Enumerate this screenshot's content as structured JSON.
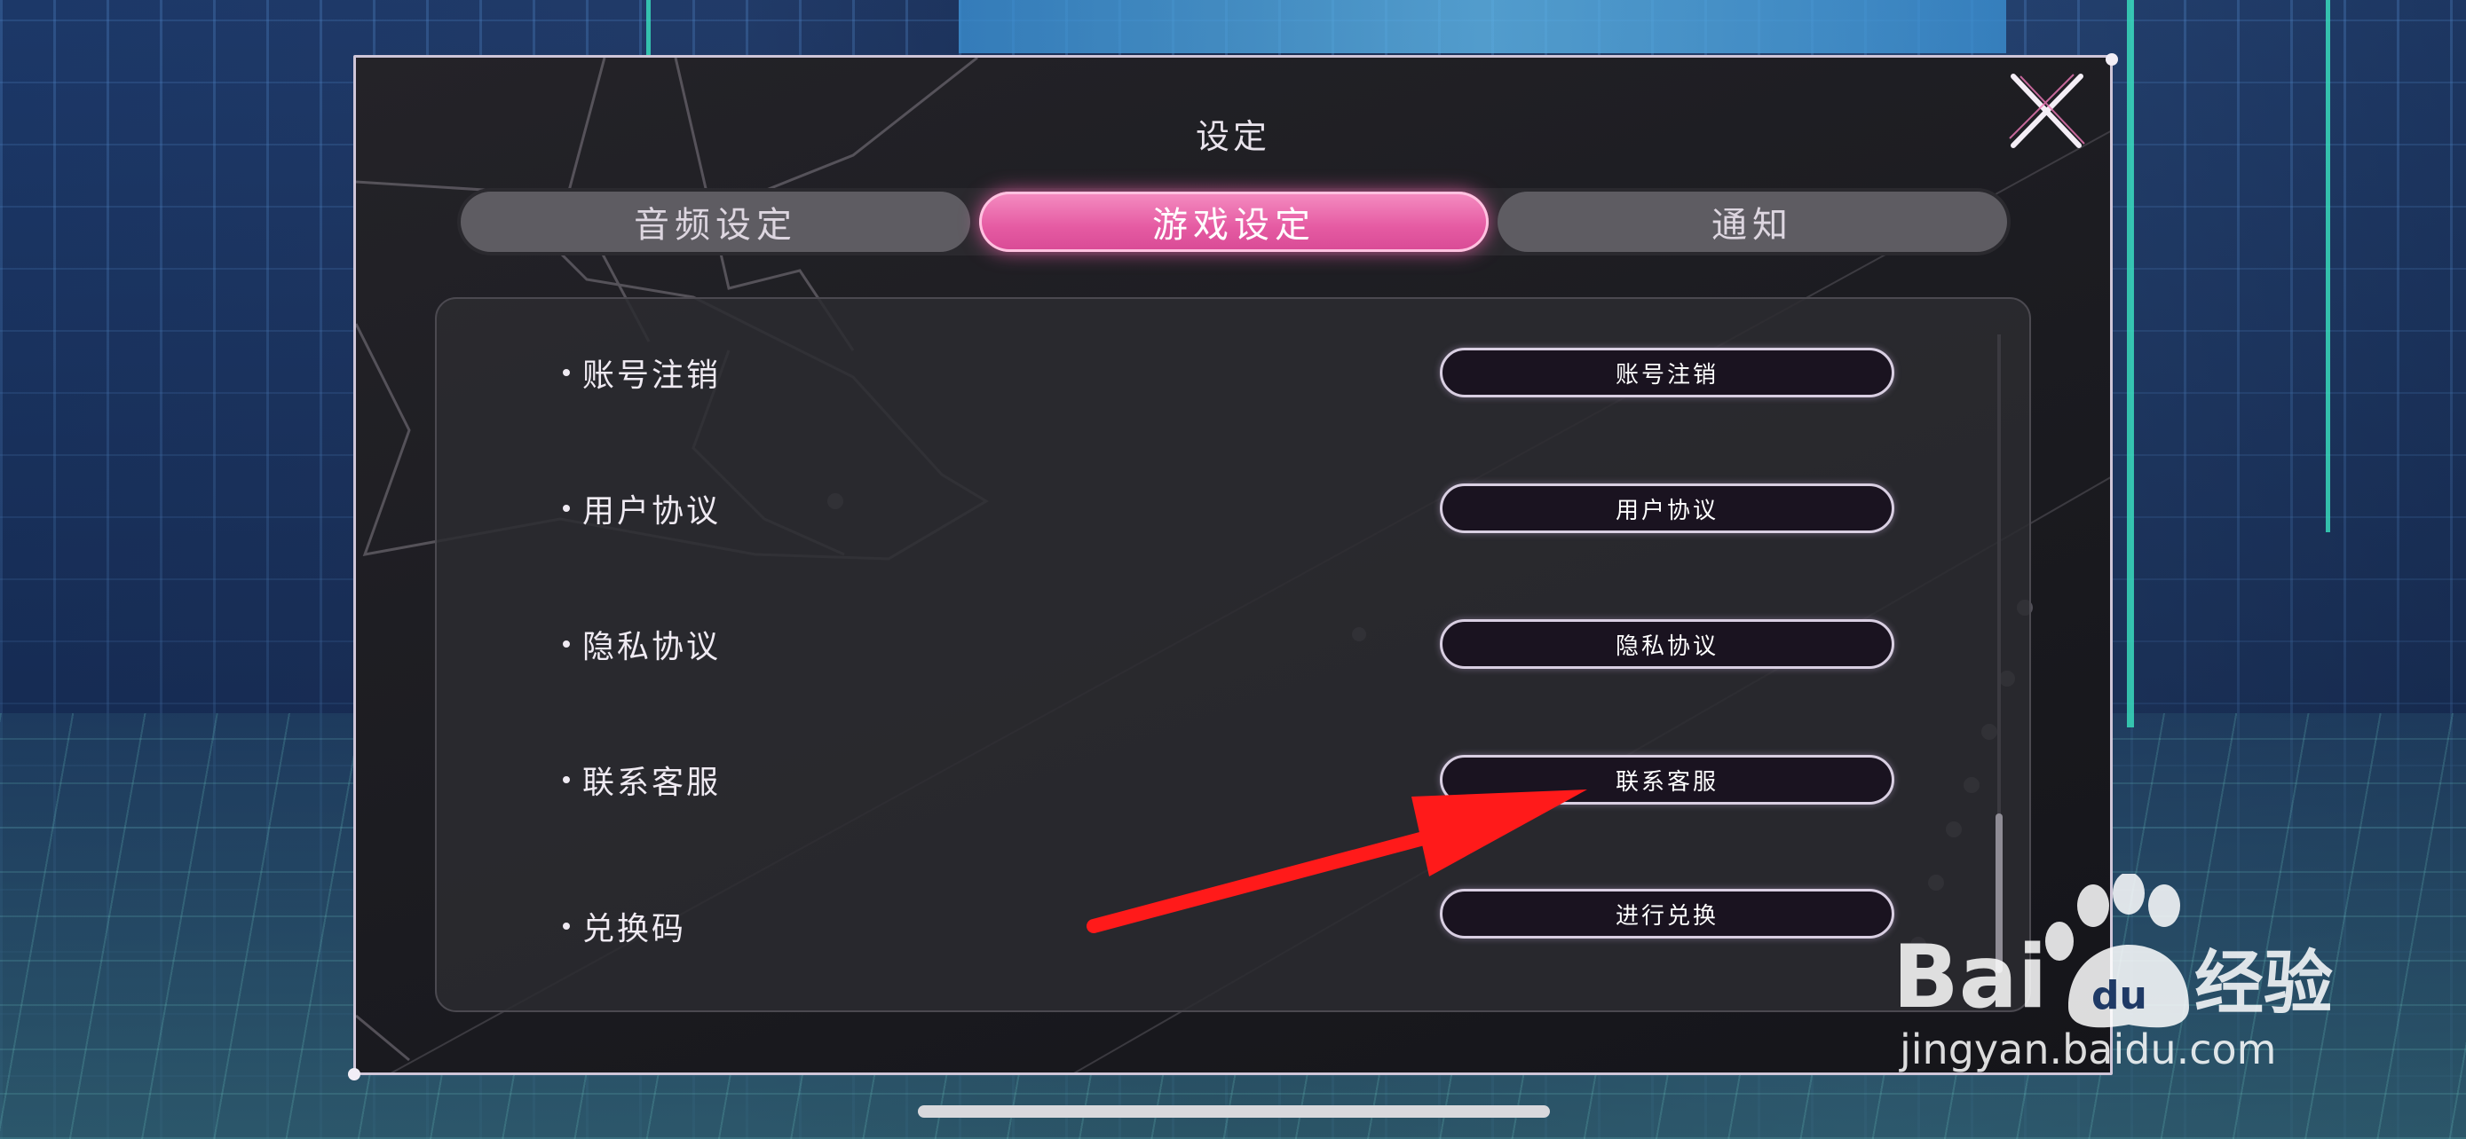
{
  "dialog": {
    "title": "设定",
    "close_icon": "close-x-icon"
  },
  "tabs": [
    {
      "label": "音频设定",
      "active": false
    },
    {
      "label": "游戏设定",
      "active": true
    },
    {
      "label": "通知",
      "active": false
    }
  ],
  "settings_rows": [
    {
      "label": "账号注销",
      "button": "账号注销"
    },
    {
      "label": "用户协议",
      "button": "用户协议"
    },
    {
      "label": "隐私协议",
      "button": "隐私协议"
    },
    {
      "label": "联系客服",
      "button": "联系客服"
    },
    {
      "label": "兑换码",
      "button": "进行兑换"
    }
  ],
  "watermark": {
    "brand": "Baidu经验",
    "url": "jingyan.baidu.com"
  },
  "colors": {
    "active_tab": "#e55aa2",
    "annotation_arrow": "#ff1a1a",
    "panel_bg": "#1f1e23"
  }
}
